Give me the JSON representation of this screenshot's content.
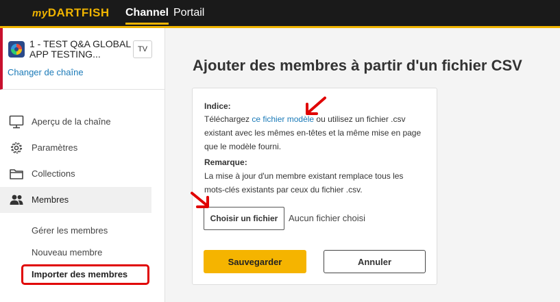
{
  "topbar": {
    "logo_prefix": "my",
    "logo_main": "DARTFISH",
    "tabs": [
      {
        "label": "Channel",
        "active": true
      },
      {
        "label": "Portail",
        "active": false
      }
    ],
    "accent_color": "#f0b400"
  },
  "sidebar": {
    "channel_name": "1 - TEST Q&A GLOBAL APP TESTING...",
    "channel_badge": "TV",
    "change_channel": "Changer de chaîne",
    "nav": [
      {
        "label": "Aperçu de la chaîne",
        "icon": "monitor-icon"
      },
      {
        "label": "Paramètres",
        "icon": "gear-icon"
      },
      {
        "label": "Collections",
        "icon": "folder-icon"
      },
      {
        "label": "Membres",
        "icon": "users-icon",
        "active": true
      }
    ],
    "sub_nav": [
      {
        "label": "Gérer les membres"
      },
      {
        "label": "Nouveau membre"
      },
      {
        "label": "Importer des membres",
        "active": true
      }
    ]
  },
  "main": {
    "title": "Ajouter des membres à partir d'un fichier CSV",
    "hint_heading": "Indice:",
    "hint_before_link": "Téléchargez ",
    "hint_link": "ce fichier modèle",
    "hint_after_link": " ou utilisez un fichier .csv",
    "hint_line2": "existant avec les mêmes en-têtes et la même mise en page",
    "hint_line3": "que le modèle fourni.",
    "note_heading": "Remarque:",
    "note_line1": "La mise à jour d'un membre existant remplace tous les",
    "note_line2": "mots-clés existants par ceux du fichier .csv.",
    "choose_file": "Choisir un fichier",
    "no_file": "Aucun fichier choisi",
    "save": "Sauvegarder",
    "cancel": "Annuler"
  }
}
